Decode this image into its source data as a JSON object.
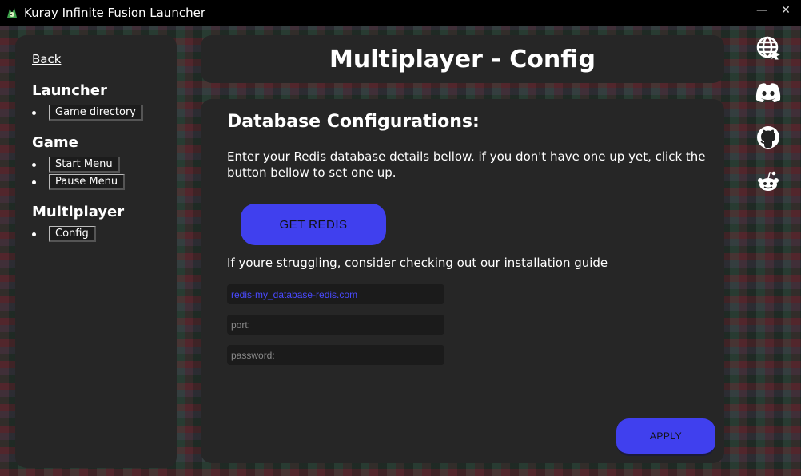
{
  "window": {
    "title": "Kuray Infinite Fusion Launcher",
    "minimize_label": "—",
    "close_label": "✕"
  },
  "sidebar": {
    "back_label": "Back",
    "sections": [
      {
        "heading": "Launcher",
        "items": [
          "Game directory"
        ]
      },
      {
        "heading": "Game",
        "items": [
          "Start Menu",
          "Pause Menu"
        ]
      },
      {
        "heading": "Multiplayer",
        "items": [
          "Config"
        ]
      }
    ]
  },
  "header": {
    "title": "Multiplayer - Config"
  },
  "main": {
    "heading": "Database Configurations:",
    "description": "Enter your Redis database details bellow. if you don't have one up yet, click the button bellow to set one up.",
    "get_redis_label": "GET REDIS",
    "struggle_text": "If youre struggling, consider checking out our ",
    "guide_link": "installation guide",
    "host_value": "redis-my_database-redis.com",
    "port_placeholder": "port:",
    "password_placeholder": "password:",
    "apply_label": "APPLY"
  },
  "social_icons": [
    "globe-icon",
    "discord-icon",
    "github-icon",
    "reddit-icon"
  ],
  "colors": {
    "accent": "#4040ee",
    "panel": "#262626",
    "titlebar": "#000000"
  }
}
